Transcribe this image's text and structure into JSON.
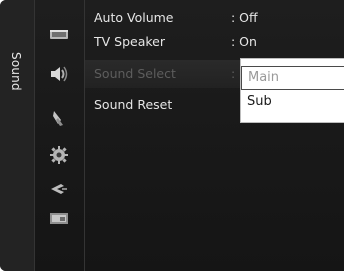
{
  "category": {
    "label": "Sound"
  },
  "icons": [
    "picture-icon",
    "sound-icon",
    "channel-icon",
    "setup-icon",
    "input-icon",
    "application-icon"
  ],
  "menu": {
    "items": [
      {
        "label": "Auto Volume",
        "value": ": Off",
        "enabled": true
      },
      {
        "label": "TV Speaker",
        "value": ": On",
        "enabled": true
      },
      {
        "label": "Sound Select",
        "value": ":",
        "enabled": false,
        "focused": true
      },
      {
        "label": "Sound Reset",
        "value": "",
        "enabled": true
      }
    ]
  },
  "dropdown": {
    "options": [
      "Main",
      "Sub"
    ],
    "selected": "Main"
  },
  "colors": {
    "panel": "#1b1b1b",
    "text": "#e6e6e6",
    "disabled_text": "#5d5d5d",
    "dropdown_bg": "#ffffff"
  }
}
